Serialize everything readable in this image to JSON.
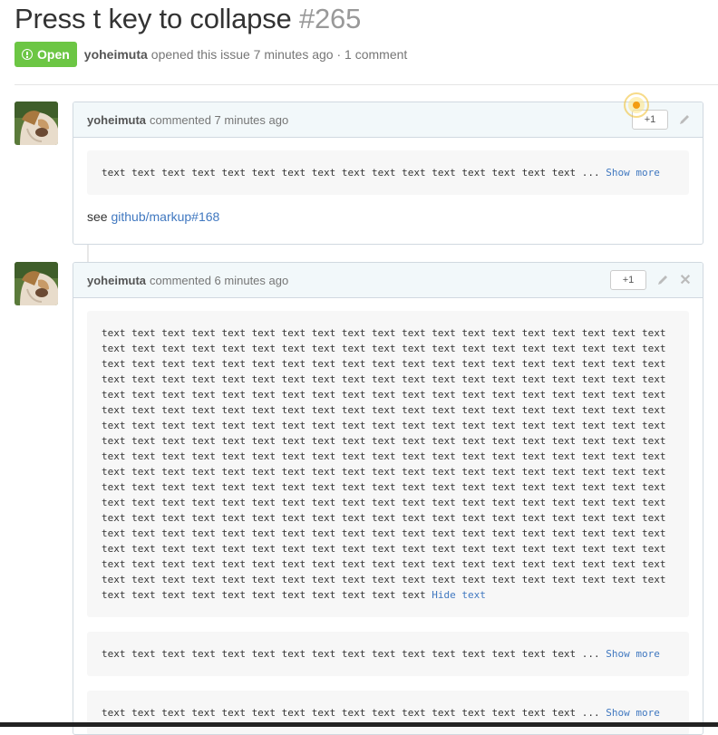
{
  "issue": {
    "title": "Press t key to collapse",
    "number": "#265",
    "state": "Open",
    "author": "yoheimuta",
    "meta_rest": "opened this issue 7 minutes ago · 1 comment"
  },
  "comments": [
    {
      "author": "yoheimuta",
      "meta": "commented 7 minutes ago",
      "plus_label": "+1",
      "code_blocks": [
        {
          "text": "text text text text text text text text text text text text text text text text ... ",
          "toggle": "Show more"
        }
      ],
      "paragraph": {
        "prefix": "see ",
        "link": "github/markup#168"
      }
    },
    {
      "author": "yoheimuta",
      "meta": "commented 6 minutes ago",
      "plus_label": "+1",
      "close_label": "✕",
      "code_blocks": [
        {
          "text": "text text text text text text text text text text text text text text text text text text text\ntext text text text text text text text text text text text text text text text text text text\ntext text text text text text text text text text text text text text text text text text text\ntext text text text text text text text text text text text text text text text text text text\ntext text text text text text text text text text text text text text text text text text text\ntext text text text text text text text text text text text text text text text text text text\ntext text text text text text text text text text text text text text text text text text text\ntext text text text text text text text text text text text text text text text text text text\ntext text text text text text text text text text text text text text text text text text text\ntext text text text text text text text text text text text text text text text text text text\ntext text text text text text text text text text text text text text text text text text text\ntext text text text text text text text text text text text text text text text text text text\ntext text text text text text text text text text text text text text text text text text text\ntext text text text text text text text text text text text text text text text text text text\ntext text text text text text text text text text text text text text text text text text text\ntext text text text text text text text text text text text text text text text text text text\ntext text text text text text text text text text text text text text text text text text text\ntext text text text text text text text text text text ",
          "toggle": "Hide text"
        },
        {
          "text": "text text text text text text text text text text text text text text text text ... ",
          "toggle": "Show more"
        },
        {
          "text": "text text text text text text text text text text text text text text text text ... ",
          "toggle": "Show more"
        }
      ]
    }
  ],
  "icons": {
    "open": "issue-opened-icon",
    "edit": "pencil-icon",
    "delete": "close-icon"
  },
  "colors": {
    "open_badge": "#6cc644",
    "link": "#4078c0",
    "comment_header": "#f2f8fa"
  }
}
